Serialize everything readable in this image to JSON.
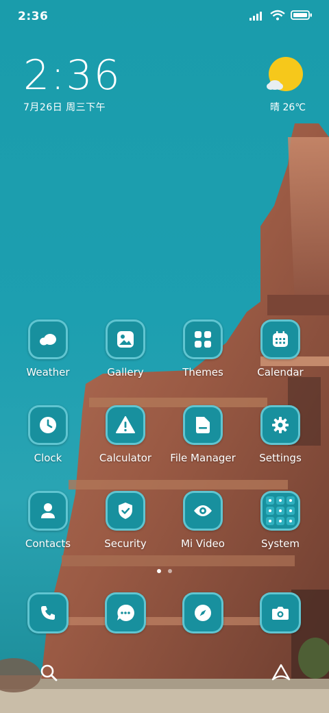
{
  "status_bar": {
    "time": "2:36",
    "icons": [
      "signal-icon",
      "wifi-icon",
      "battery-icon"
    ]
  },
  "clock_widget": {
    "time": "2:36",
    "date": "7月26日 周三下午"
  },
  "weather_widget": {
    "icon": "sun-cloud-icon",
    "text": "晴 26℃"
  },
  "apps": [
    {
      "label": "Weather",
      "icon": "cloud-icon"
    },
    {
      "label": "Gallery",
      "icon": "image-icon"
    },
    {
      "label": "Themes",
      "icon": "grid-icon"
    },
    {
      "label": "Calendar",
      "icon": "calendar-icon"
    },
    {
      "label": "Clock",
      "icon": "clock-icon"
    },
    {
      "label": "Calculator",
      "icon": "warning-icon"
    },
    {
      "label": "File Manager",
      "icon": "folder-icon"
    },
    {
      "label": "Settings",
      "icon": "gear-icon"
    },
    {
      "label": "Contacts",
      "icon": "person-icon"
    },
    {
      "label": "Security",
      "icon": "shield-icon"
    },
    {
      "label": "Mi Video",
      "icon": "eye-icon"
    },
    {
      "label": "System",
      "icon": "folder-grid-icon"
    }
  ],
  "dock": [
    {
      "icon": "phone-icon"
    },
    {
      "icon": "chat-icon"
    },
    {
      "icon": "compass-icon"
    },
    {
      "icon": "camera-icon"
    }
  ],
  "page_indicator": {
    "pages": 2,
    "active": 1
  },
  "bottom_bar": [
    "search-icon",
    "assistant-icon"
  ],
  "colors": {
    "wallpaper_sky": "#1d9fb0",
    "tile": "#18909e",
    "tile_border": "#78d7e1",
    "sun": "#f6c81b"
  }
}
